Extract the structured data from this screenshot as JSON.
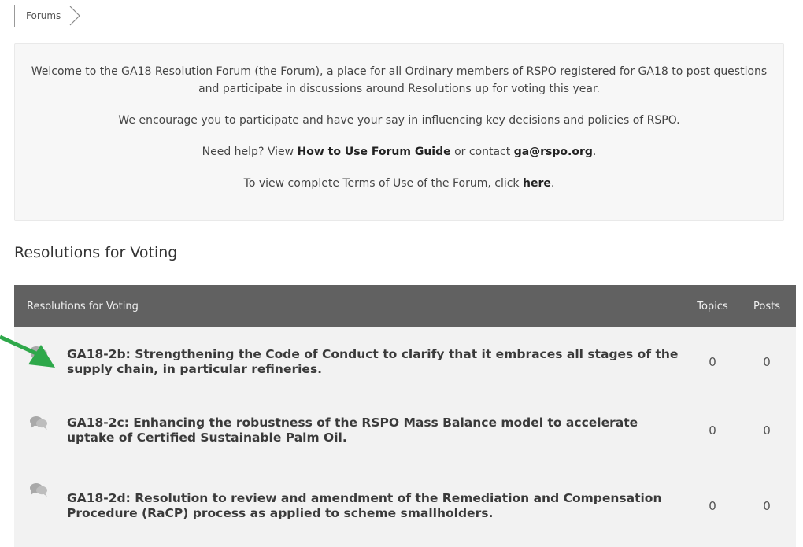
{
  "breadcrumb": {
    "forums_label": "Forums"
  },
  "welcome": {
    "intro": "Welcome to the GA18 Resolution Forum (the Forum), a place for all Ordinary members of RSPO registered for GA18 to post questions and participate in discussions around Resolutions up for voting this year.",
    "encourage": "We encourage you to participate and have your say in influencing key decisions and policies of RSPO.",
    "help_prefix": "Need help? View ",
    "help_guide_link": "How to Use Forum Guide",
    "help_middle": " or contact ",
    "help_email": "ga@rspo.org",
    "help_suffix": ".",
    "terms_prefix": "To view complete Terms of Use of the Forum, click ",
    "terms_link": "here",
    "terms_suffix": "."
  },
  "section_title": "Resolutions for Voting",
  "table": {
    "header": {
      "title": "Resolutions for Voting",
      "topics": "Topics",
      "posts": "Posts"
    },
    "rows": [
      {
        "title": "GA18-2b: Strengthening the Code of Conduct to clarify that it embraces all stages of the supply chain, in particular refineries.",
        "topics": "0",
        "posts": "0"
      },
      {
        "title": "GA18-2c: Enhancing the robustness of the RSPO Mass Balance model to accelerate uptake of Certified Sustainable Palm Oil.",
        "topics": "0",
        "posts": "0"
      },
      {
        "title": "GA18-2d: Resolution to review and amendment of the Remediation and Compensation Procedure (RaCP) process as applied to scheme smallholders.",
        "topics": "0",
        "posts": "0"
      }
    ]
  },
  "colors": {
    "header_bg": "#616161",
    "row_bg": "#f2f2f2",
    "panel_bg": "#f7f7f7",
    "arrow": "#2ea84a"
  },
  "icons": {
    "row_icon": "chat-bubbles-icon",
    "breadcrumb_separator": "chevron-right-icon",
    "annotation": "green-arrow-icon"
  }
}
